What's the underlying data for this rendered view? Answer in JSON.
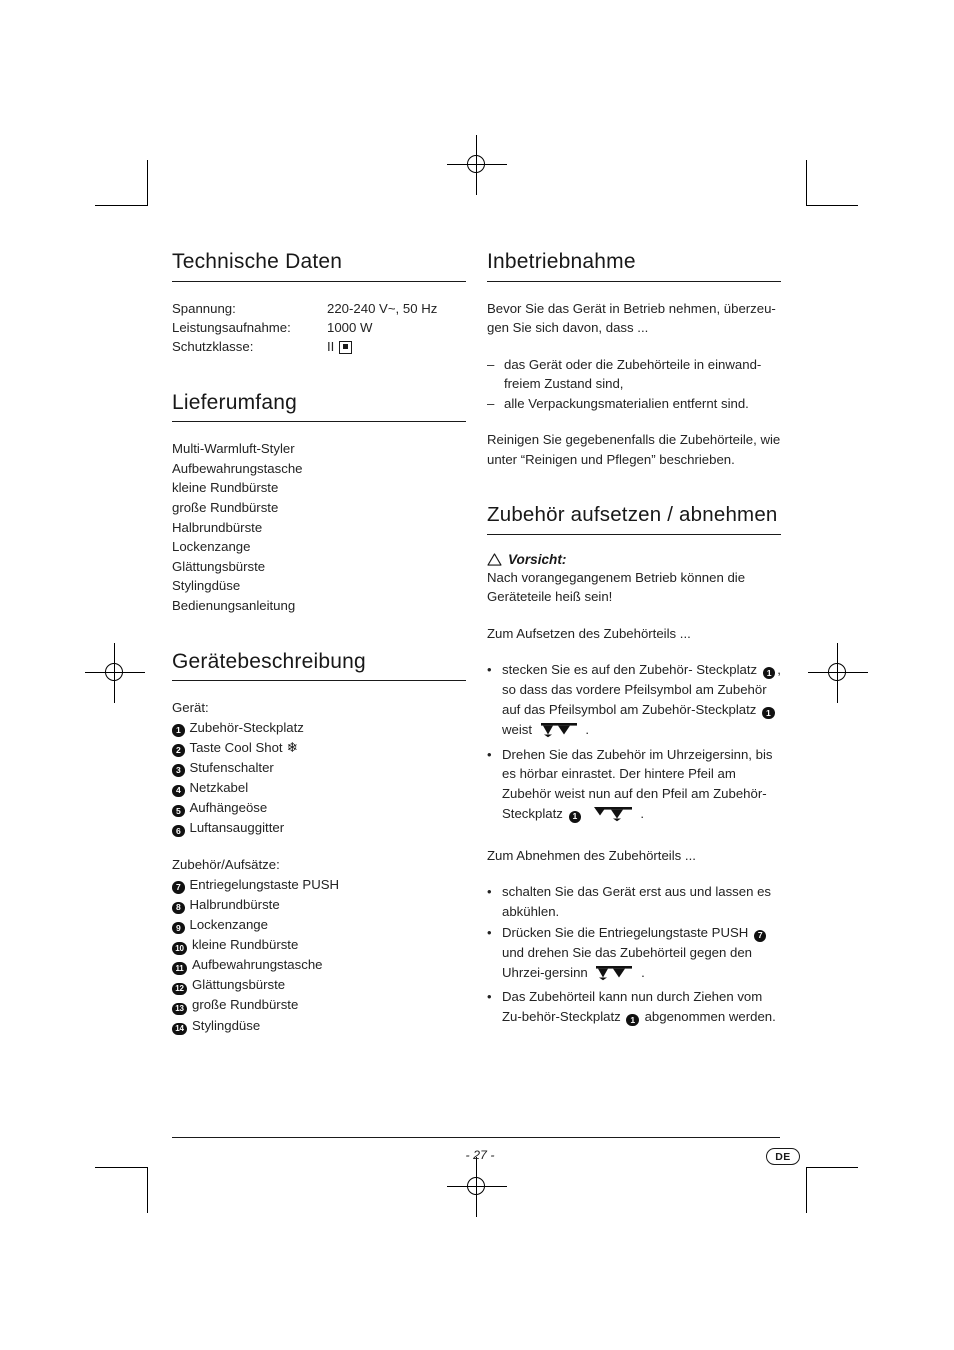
{
  "document": {
    "language_badge": "DE",
    "page_number": "- 27 -"
  },
  "left_column": {
    "technical_data": {
      "heading": "Technische Daten",
      "rows": [
        {
          "label": "Spannung:",
          "value": "220-240 V~, 50 Hz"
        },
        {
          "label": "Leistungsaufnahme:",
          "value": "1000 W"
        },
        {
          "label": "Schutzklasse:",
          "value": "II"
        }
      ],
      "protection_class_symbol": "double-insulation-square"
    },
    "scope_of_delivery": {
      "heading": "Lieferumfang",
      "items": [
        "Multi-Warmluft-Styler",
        "Aufbewahrungstasche",
        "kleine Rundbürste",
        "große Rundbürste",
        "Halbrundbürste",
        "Lockenzange",
        "Glättungsbürste",
        "Stylingdüse",
        "Bedienungsanleitung"
      ]
    },
    "device_description": {
      "heading": "Gerätebeschreibung",
      "device_label": "Gerät:",
      "device_items": [
        {
          "number": "1",
          "label": "Zubehör-Steckplatz",
          "icon": ""
        },
        {
          "number": "2",
          "label": "Taste Cool Shot",
          "icon": "snowflake-icon"
        },
        {
          "number": "3",
          "label": "Stufenschalter",
          "icon": ""
        },
        {
          "number": "4",
          "label": "Netzkabel",
          "icon": ""
        },
        {
          "number": "5",
          "label": "Aufhängeöse",
          "icon": ""
        },
        {
          "number": "6",
          "label": "Luftansauggitter",
          "icon": ""
        }
      ],
      "accessories_label": "Zubehör/Aufsätze:",
      "accessory_items": [
        {
          "number": "7",
          "label": "Entriegelungstaste PUSH"
        },
        {
          "number": "8",
          "label": "Halbrundbürste"
        },
        {
          "number": "9",
          "label": "Lockenzange"
        },
        {
          "number": "10",
          "label": "kleine Rundbürste"
        },
        {
          "number": "11",
          "label": "Aufbewahrungstasche"
        },
        {
          "number": "12",
          "label": "Glättungsbürste"
        },
        {
          "number": "13",
          "label": "große Rundbürste"
        },
        {
          "number": "14",
          "label": "Stylingdüse"
        }
      ]
    }
  },
  "right_column": {
    "commissioning": {
      "heading": "Inbetriebnahme",
      "intro": "Bevor Sie das Gerät in Betrieb nehmen, überzeu-gen Sie sich davon, dass ...",
      "checks": [
        "das Gerät oder die Zubehörteile in einwand-freiem Zustand sind,",
        "alle Verpackungsmaterialien entfernt sind."
      ],
      "closing": "Reinigen Sie gegebenenfalls die Zubehörteile, wie unter “Reinigen und Pflegen” beschrieben."
    },
    "attach_detach": {
      "heading": "Zubehör aufsetzen / abnehmen",
      "caution_label": "Vorsicht:",
      "caution_text": "Nach vorangegangenem Betrieb können die Geräteteile heiß sein!",
      "attach_intro": "Zum Aufsetzen des Zubehörteils ...",
      "attach_steps": [
        {
          "part_a": "stecken Sie es auf den Zubehör- Steckplatz ",
          "badge_1": "1",
          "part_b": ", so dass das vordere Pfeilsymbol am Zubehör auf das Pfeilsymbol am Zubehör-Steckplatz ",
          "badge_2": "1",
          "part_c": " weist ",
          "symbol": "arrow-align-up-down",
          "part_d": " ."
        },
        {
          "part_a": "Drehen Sie das Zubehör im Uhrzeigersinn, bis es hörbar einrastet. Der hintere Pfeil am Zubehör weist nun auf den Pfeil am Zubehör-Steckplatz ",
          "badge_1": "1",
          "part_b": " ",
          "symbol": "arrow-align-down-up",
          "part_c": " ."
        }
      ],
      "detach_intro": "Zum Abnehmen des Zubehörteils ...",
      "detach_steps": [
        {
          "part_a": "schalten Sie das Gerät erst aus und lassen es abkühlen."
        },
        {
          "part_a": "Drücken Sie die Entriegelungstaste PUSH ",
          "badge_1": "7",
          "part_b": " und drehen Sie das Zubehörteil gegen den Uhrzei-gersinn ",
          "symbol": "arrow-align-up-down",
          "part_c": " ."
        },
        {
          "part_a": "Das Zubehörteil kann nun durch Ziehen vom Zu-behör-Steckplatz ",
          "badge_1": "1",
          "part_b": " abgenommen werden."
        }
      ]
    }
  }
}
